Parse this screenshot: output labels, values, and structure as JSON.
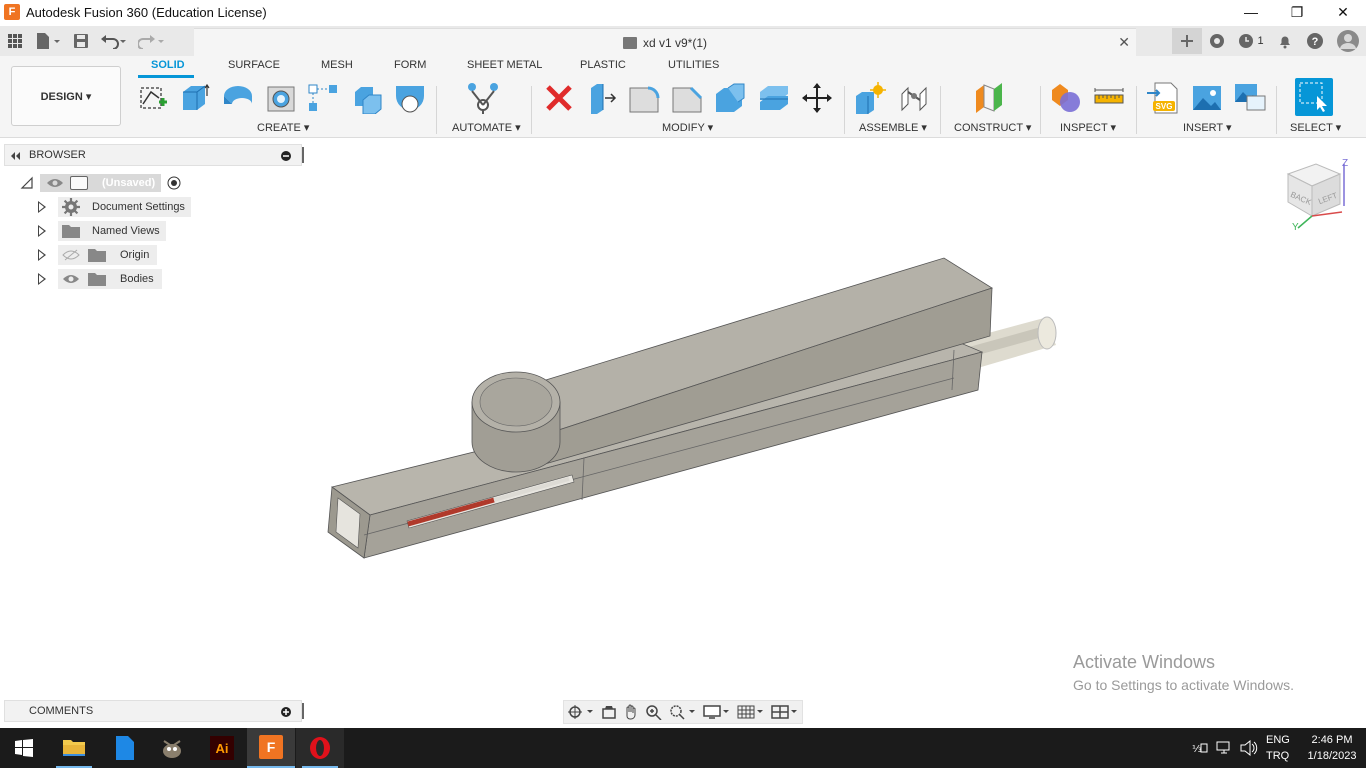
{
  "window": {
    "title": "Autodesk Fusion 360 (Education License)",
    "app_icon_letter": "F",
    "minimize": "—",
    "restore": "❐",
    "close": "✕"
  },
  "doc_tab": {
    "title": "xd v1 v9*(1)",
    "close": "✕"
  },
  "quick_access": {
    "jobs_count": "1"
  },
  "toolbar": {
    "workspace": "DESIGN ▾",
    "tabs": [
      "SOLID",
      "SURFACE",
      "MESH",
      "FORM",
      "SHEET METAL",
      "PLASTIC",
      "UTILITIES"
    ],
    "active_tab": "SOLID",
    "groups": {
      "create": "CREATE ▾",
      "automate": "AUTOMATE ▾",
      "modify": "MODIFY ▾",
      "assemble": "ASSEMBLE ▾",
      "construct": "CONSTRUCT ▾",
      "inspect": "INSPECT ▾",
      "insert": "INSERT ▾",
      "select": "SELECT ▾"
    }
  },
  "browser": {
    "title": "BROWSER",
    "root": "(Unsaved)",
    "items": [
      "Document Settings",
      "Named Views",
      "Origin",
      "Bodies"
    ]
  },
  "comments": {
    "title": "COMMENTS"
  },
  "viewcube": {
    "face_back": "BACK",
    "face_left": "LEFT",
    "axis_z": "Z",
    "axis_y": "Y"
  },
  "watermark": {
    "title": "Activate Windows",
    "subtitle": "Go to Settings to activate Windows."
  },
  "taskbar": {
    "ai_label": "Ai",
    "fusion_label": "F",
    "lang": "ENG",
    "kbd": "TRQ",
    "time": "2:46 PM",
    "date": "1/18/2023"
  },
  "colors": {
    "accent": "#0696d7",
    "model_body": "#a9a69d",
    "model_top": "#bdbab1",
    "rod": "#e2dfd4",
    "red_stripe": "#b03a2e"
  }
}
